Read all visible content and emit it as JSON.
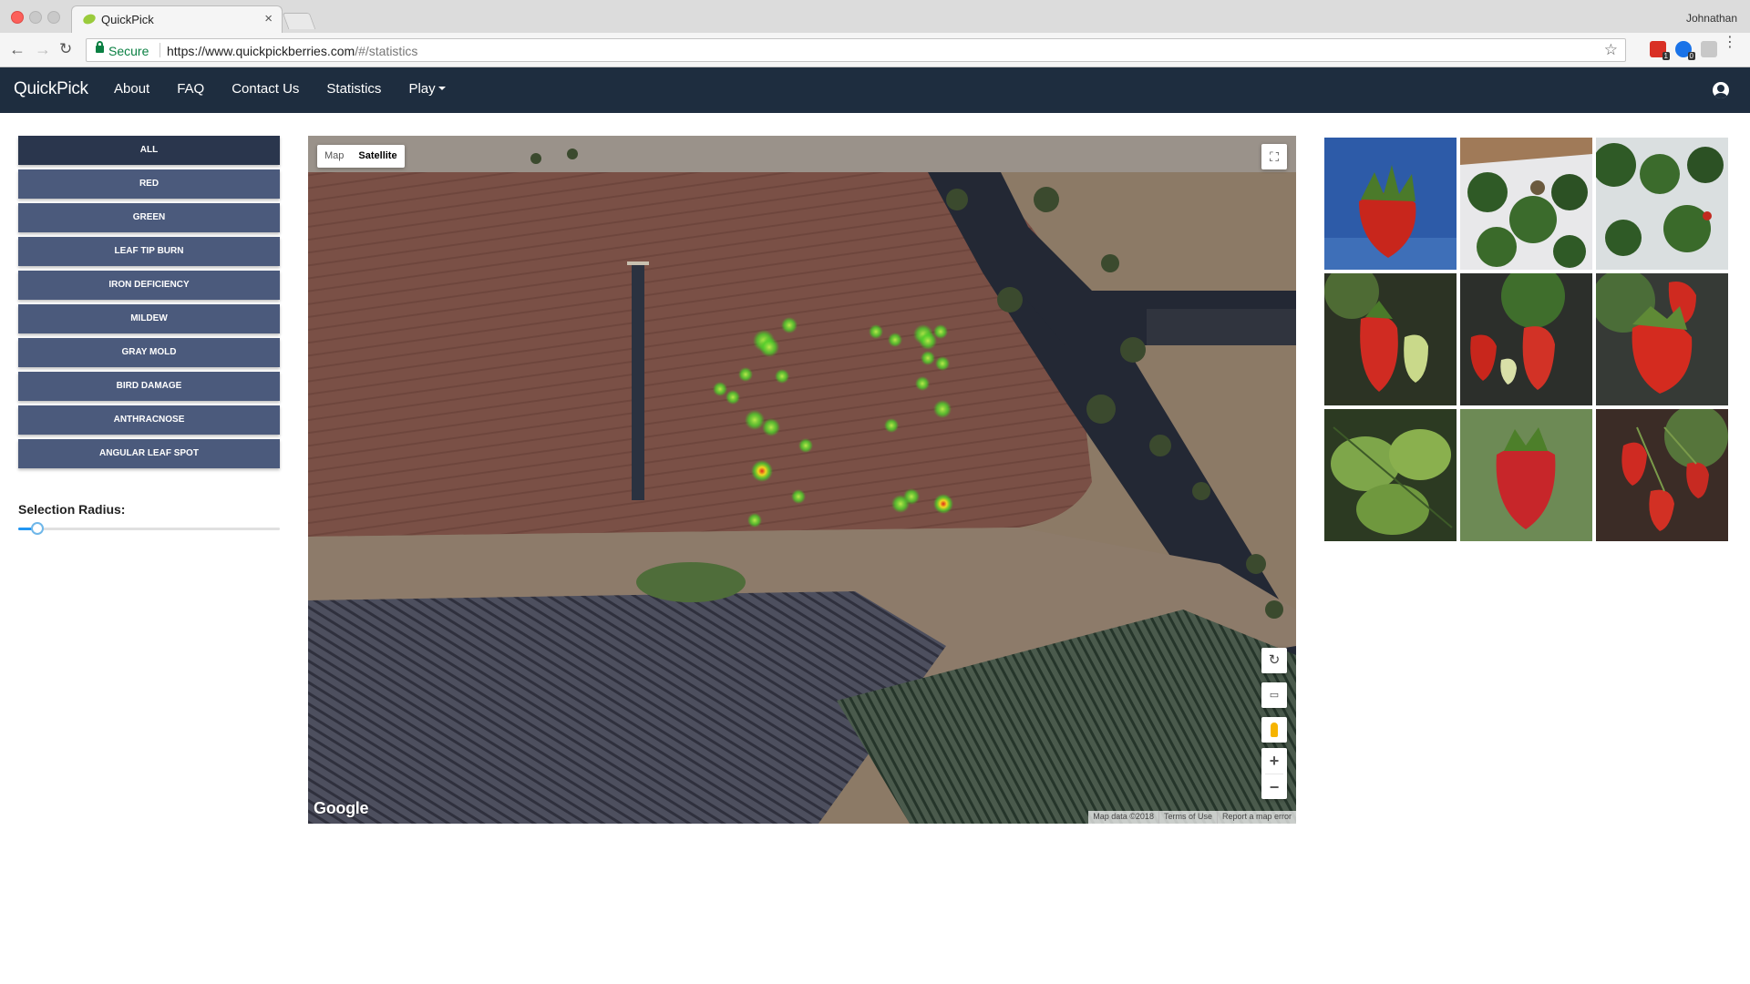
{
  "browser": {
    "tab_title": "QuickPick",
    "tab_close": "×",
    "user_name": "Johnathan",
    "secure_label": "Secure",
    "url_main": "https://www.quickpickberries.com",
    "url_rest": "/#/statistics",
    "icons": [
      "back-icon",
      "forward-icon",
      "reload-icon",
      "lock-icon",
      "star-icon",
      "menu-icon"
    ]
  },
  "navbar": {
    "brand": "QuickPick",
    "links": [
      "About",
      "FAQ",
      "Contact Us",
      "Statistics"
    ],
    "dropdown": "Play",
    "account_icon": "account-circle-icon",
    "bg_color": "#1e2d3f"
  },
  "filters": {
    "buttons": [
      "ALL",
      "RED",
      "GREEN",
      "LEAF TIP BURN",
      "IRON DEFICIENCY",
      "MILDEW",
      "GRAY MOLD",
      "BIRD DAMAGE",
      "ANTHRACNOSE",
      "ANGULAR LEAF SPOT"
    ],
    "active": "ALL",
    "button_color": "#4b5a7c",
    "active_color": "#2a364d"
  },
  "radius": {
    "label": "Selection Radius:",
    "value_fraction": 0.05
  },
  "map": {
    "map_type_options": [
      "Map",
      "Satellite"
    ],
    "selected_type": "Satellite",
    "logo": "Google",
    "attribution": [
      "Map data ©2018",
      "Terms of Use",
      "Report a map error"
    ],
    "controls": [
      "fullscreen-icon",
      "rotate-icon",
      "tilt-icon",
      "pegman-icon",
      "zoom-in-icon",
      "zoom-out-icon"
    ],
    "zoom_in": "+",
    "zoom_out": "−"
  },
  "gallery": {
    "images": [
      "strawberry-sky",
      "strawberry-plants-white",
      "strawberry-plants-row",
      "strawberry-pair-vine",
      "strawberry-cluster",
      "strawberry-closeup",
      "strawberry-leaves",
      "strawberry-single",
      "strawberry-hanging"
    ]
  }
}
